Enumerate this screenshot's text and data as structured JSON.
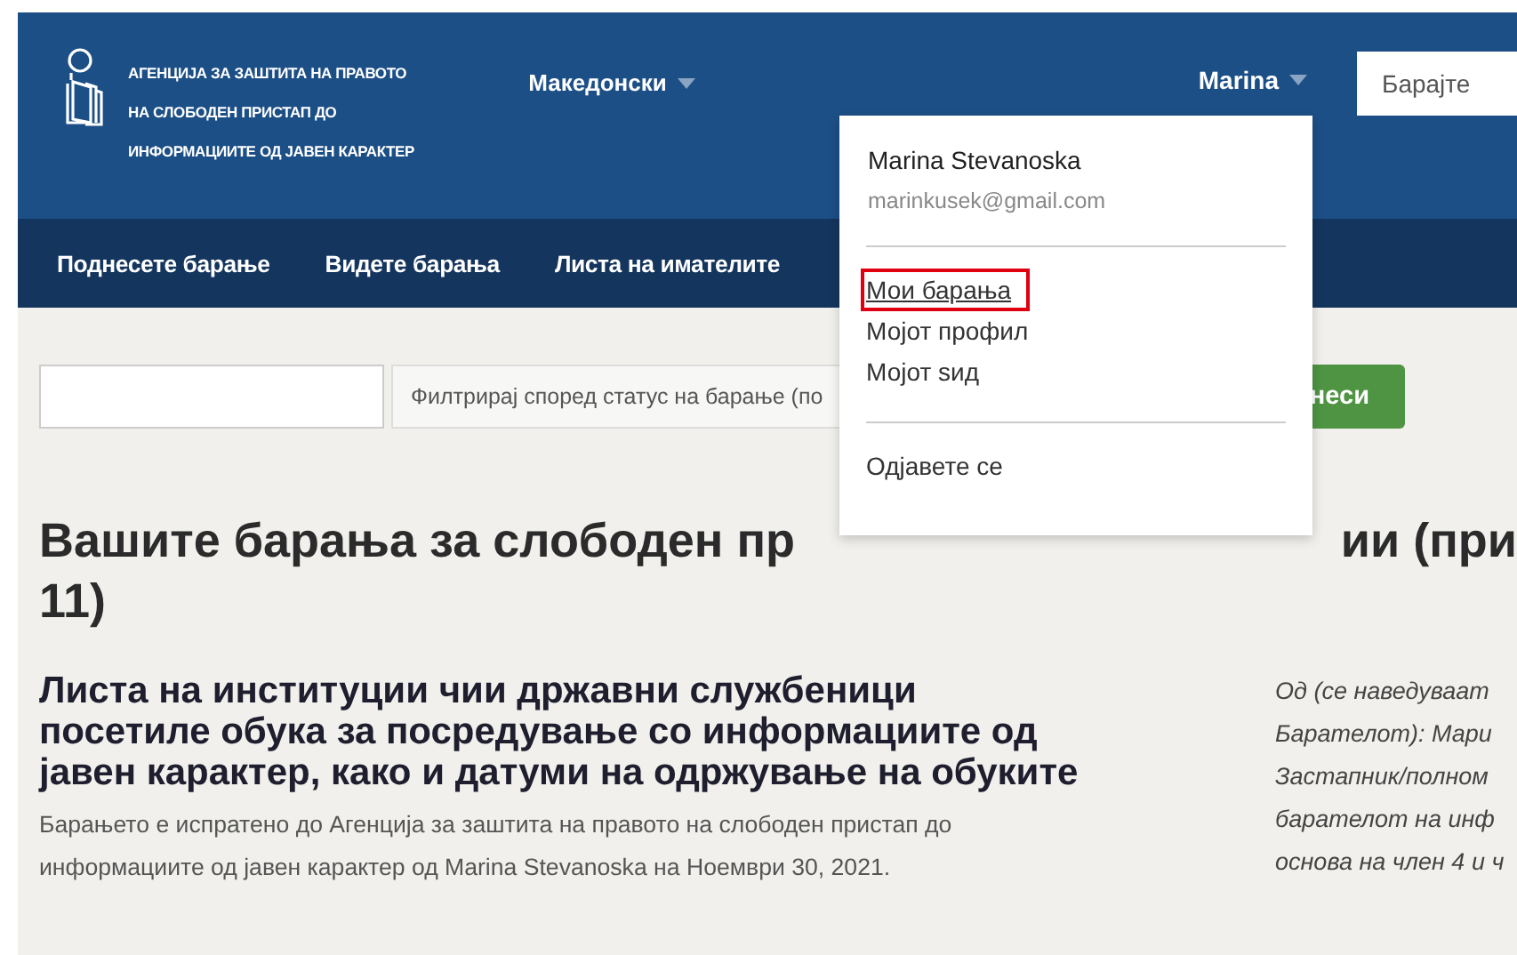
{
  "header": {
    "logo_lines": [
      "АГЕНЦИЈА ЗА ЗАШТИТА НА ПРАВОТО",
      "НА СЛОБОДЕН ПРИСТАП ДО",
      "ИНФОРМАЦИИТЕ ОД ЈАВЕН КАРАКТЕР"
    ],
    "language": "Македонски",
    "user": "Marina",
    "search": {
      "placeholder": "Барајте"
    }
  },
  "nav": [
    {
      "label": "Поднесете барање"
    },
    {
      "label": "Видете барања"
    },
    {
      "label": "Листа на имателите"
    }
  ],
  "user_menu": {
    "name": "Marina Stevanoska",
    "email": "marinkusek@gmail.com",
    "groups": [
      [
        {
          "label": "Мои барања",
          "highlighted": true
        },
        {
          "label": "Мојот профил",
          "highlighted": false
        },
        {
          "label": "Мојот ѕид",
          "highlighted": false
        }
      ],
      [
        {
          "label": "Одјавете се",
          "highlighted": false
        }
      ]
    ]
  },
  "filter": {
    "status_placeholder": "Филтрирај според статус на барање (по",
    "button": "неси"
  },
  "heading": {
    "visible_left": "Вашите барања за слободен пр",
    "visible_right": "ии (при",
    "line_2": "11)"
  },
  "request": {
    "title": "Листа на институции чии државни службеници посетиле обука за посредување со информациите од јавен карактер, како и датуми на одржување на обуките",
    "summary": "Барањето е испратено до Агенција за заштита на правото на слободен пристап до информациите од јавен карактер од Marina Stevanoska на Ноември 30, 2021."
  },
  "side_lines": [
    "Од (се наведуваат",
    "Барателот): Мари",
    "Застапник/полном",
    "барателот на инф",
    "основа на член 4 и ч"
  ]
}
